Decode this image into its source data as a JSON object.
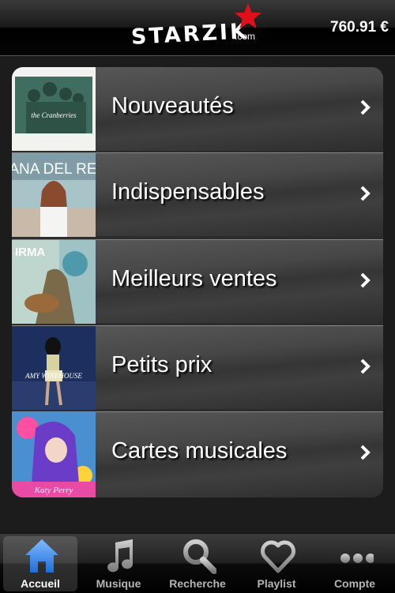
{
  "header": {
    "logo_text": "STARZIK",
    "logo_suffix": ".com",
    "balance": "760.91 €"
  },
  "menu": {
    "items": [
      {
        "label": "Nouveautés",
        "cover_text": "the Cranberries"
      },
      {
        "label": "Indispensables",
        "cover_text": "LANA DEL REY"
      },
      {
        "label": "Meilleurs ventes",
        "cover_text": "IRMA"
      },
      {
        "label": "Petits prix",
        "cover_text": "AMY WINEHOUSE"
      },
      {
        "label": "Cartes musicales",
        "cover_text": "Katy Perry"
      }
    ]
  },
  "tabbar": {
    "tabs": [
      {
        "label": "Accueil",
        "icon": "home-icon",
        "active": true
      },
      {
        "label": "Musique",
        "icon": "music-note-icon",
        "active": false
      },
      {
        "label": "Recherche",
        "icon": "search-icon",
        "active": false
      },
      {
        "label": "Playlist",
        "icon": "heart-icon",
        "active": false
      },
      {
        "label": "Compte",
        "icon": "more-icon",
        "active": false
      }
    ]
  },
  "colors": {
    "accent_star": "#e0101a",
    "home_icon_blue": "#3c8ff0",
    "text": "#ffffff"
  }
}
